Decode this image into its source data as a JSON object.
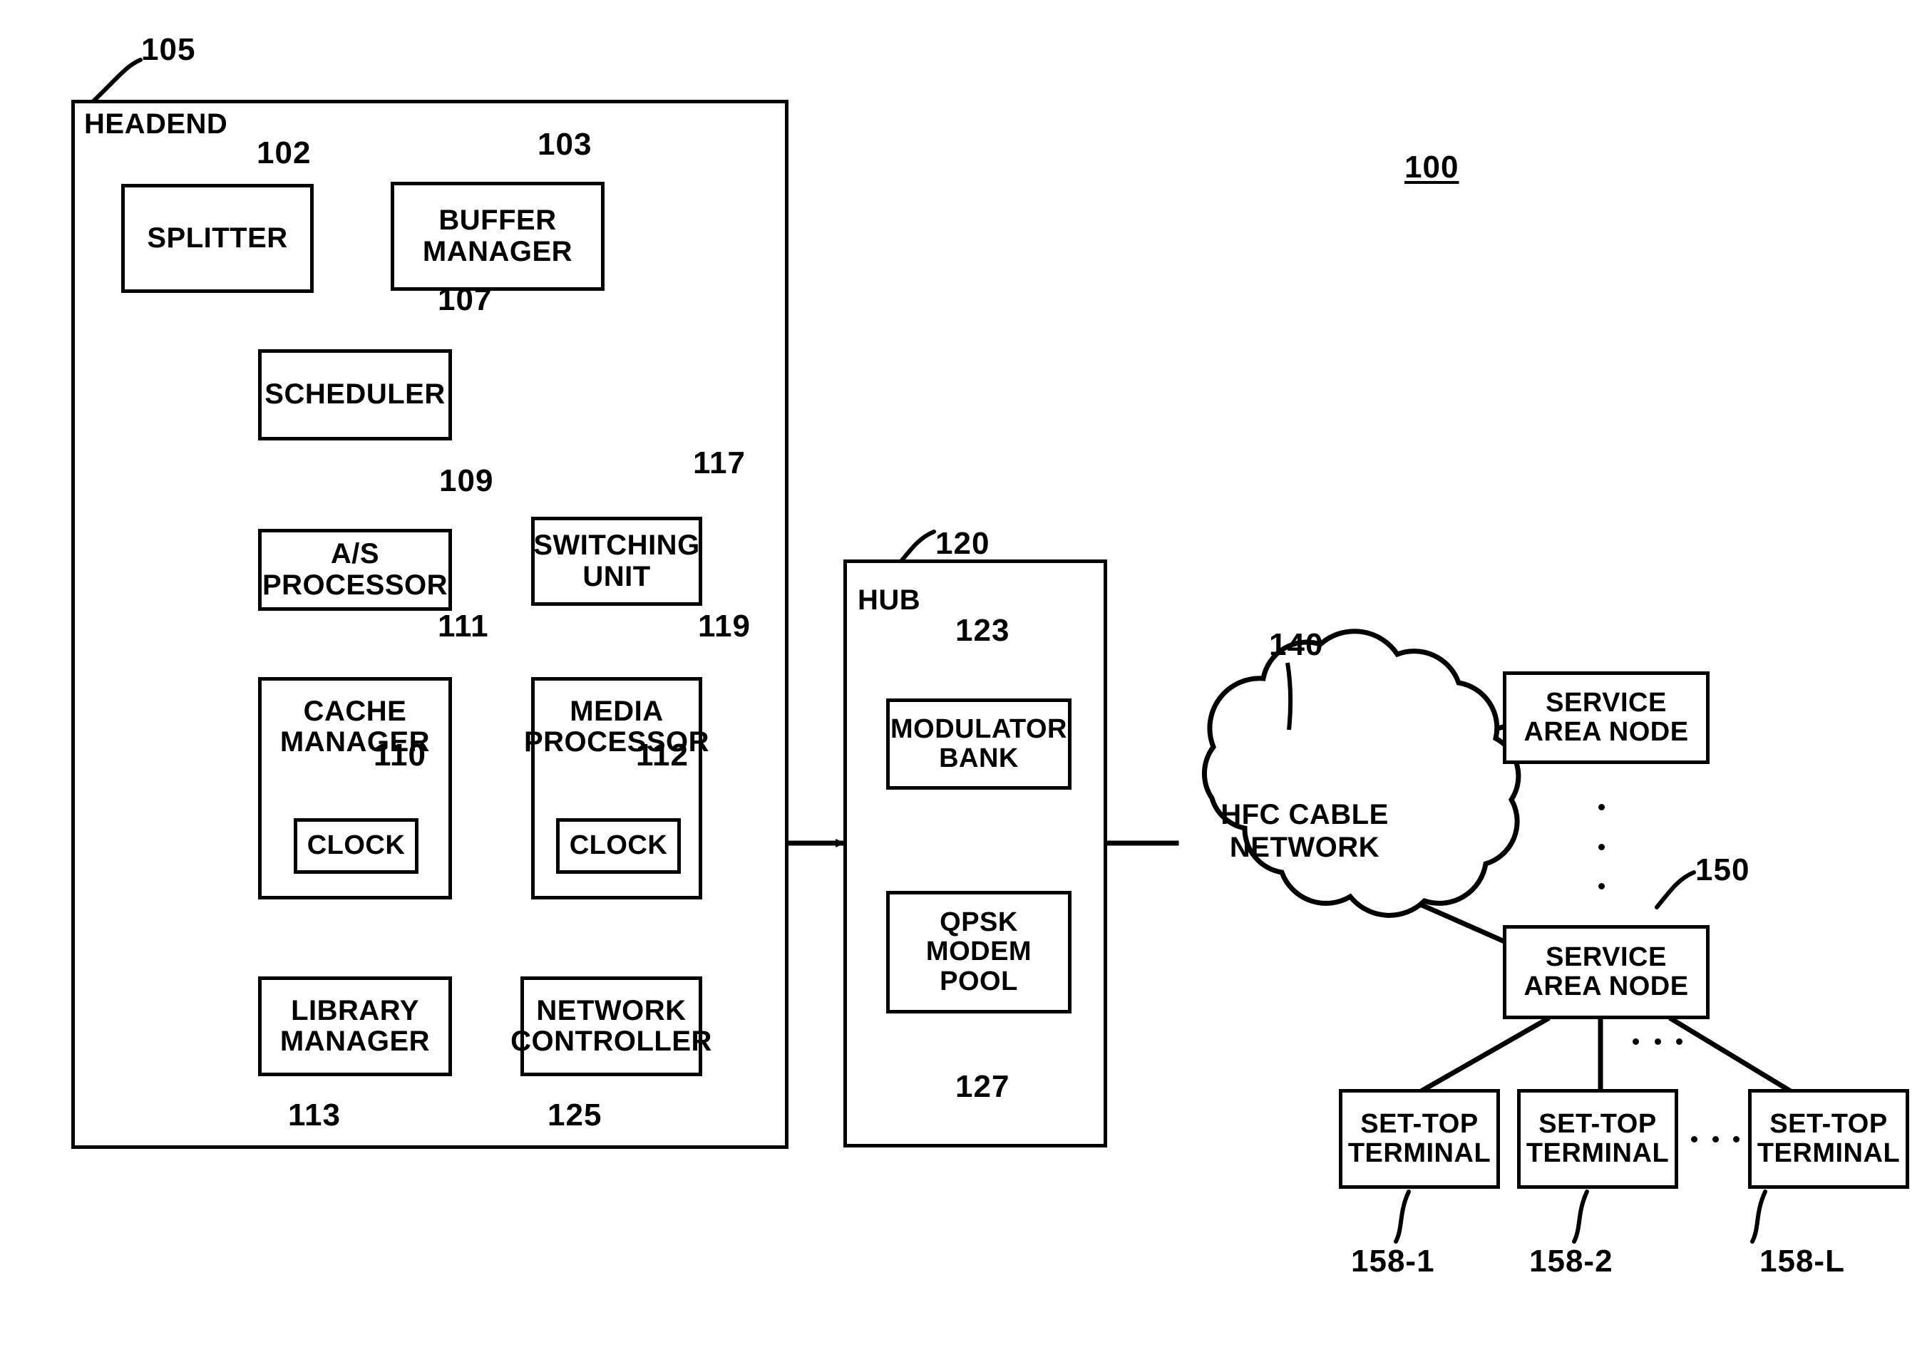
{
  "figure": {
    "figure_number": "100"
  },
  "headend": {
    "label": "HEADEND",
    "ref": "105",
    "blocks": [
      {
        "id": "splitter",
        "ref": "102",
        "lines": [
          "SPLITTER"
        ]
      },
      {
        "id": "buffer-manager",
        "ref": "103",
        "lines": [
          "BUFFER",
          "MANAGER"
        ]
      },
      {
        "id": "scheduler",
        "ref": "107",
        "lines": [
          "SCHEDULER"
        ]
      },
      {
        "id": "as-processor",
        "ref": "109",
        "lines": [
          "A/S",
          "PROCESSOR"
        ]
      },
      {
        "id": "switching-unit",
        "ref": "117",
        "lines": [
          "SWITCHING",
          "UNIT"
        ]
      },
      {
        "id": "cache-manager",
        "ref": "111",
        "lines": [
          "CACHE",
          "MANAGER"
        ]
      },
      {
        "id": "media-processor",
        "ref": "119",
        "lines": [
          "MEDIA",
          "PROCESSOR"
        ]
      },
      {
        "id": "cache-clock",
        "ref": "110",
        "lines": [
          "CLOCK"
        ]
      },
      {
        "id": "media-clock",
        "ref": "112",
        "lines": [
          "CLOCK"
        ]
      },
      {
        "id": "library-manager",
        "ref": "113",
        "lines": [
          "LIBRARY",
          "MANAGER"
        ]
      },
      {
        "id": "network-controller",
        "ref": "125",
        "lines": [
          "NETWORK",
          "CONTROLLER"
        ]
      }
    ]
  },
  "hub": {
    "label": "HUB",
    "ref": "120",
    "blocks": [
      {
        "id": "modulator-bank",
        "ref": "123",
        "lines": [
          "MODULATOR",
          "BANK"
        ]
      },
      {
        "id": "qpsk-modem-pool",
        "ref": "127",
        "lines": [
          "QPSK",
          "MODEM",
          "POOL"
        ]
      }
    ]
  },
  "network": {
    "ref": "140",
    "lines": [
      "HFC CABLE",
      "NETWORK"
    ]
  },
  "service_area_nodes": [
    {
      "id": "service-area-node-top",
      "ref": "",
      "lines": [
        "SERVICE",
        "AREA NODE"
      ]
    },
    {
      "id": "service-area-node-bottom",
      "ref": "150",
      "lines": [
        "SERVICE",
        "AREA NODE"
      ]
    }
  ],
  "set_top_terminals": [
    {
      "id": "set-top-terminal-1",
      "ref": "158-1",
      "lines": [
        "SET-TOP",
        "TERMINAL"
      ]
    },
    {
      "id": "set-top-terminal-2",
      "ref": "158-2",
      "lines": [
        "SET-TOP",
        "TERMINAL"
      ]
    },
    {
      "id": "set-top-terminal-L",
      "ref": "158-L",
      "lines": [
        "SET-TOP",
        "TERMINAL"
      ]
    }
  ],
  "ellipsis": {
    "vertical_nodes": "...",
    "horizontal_terminals": "...",
    "horizontal_top_terminals": "..."
  },
  "colors": {
    "ink": "#000000",
    "paper": "#ffffff"
  }
}
